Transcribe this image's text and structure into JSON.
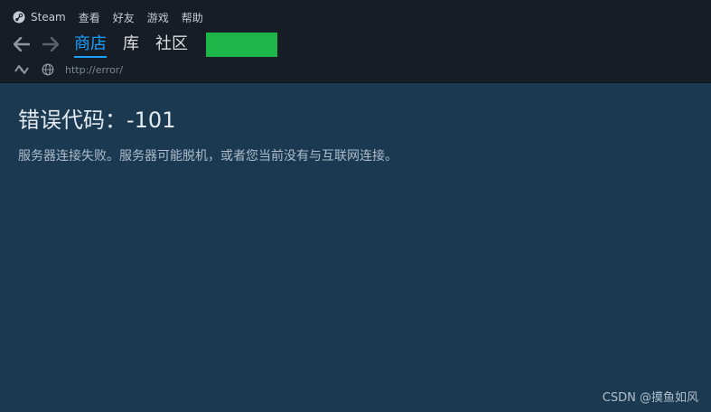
{
  "menubar": {
    "app_name": "Steam",
    "items": [
      "查看",
      "好友",
      "游戏",
      "帮助"
    ]
  },
  "nav": {
    "tabs": [
      {
        "label": "商店",
        "active": true
      },
      {
        "label": "库",
        "active": false
      },
      {
        "label": "社区",
        "active": false
      }
    ],
    "account_button_color": "#1fb649"
  },
  "urlbar": {
    "url": "http://error/"
  },
  "error": {
    "title": "错误代码：-101",
    "message": "服务器连接失败。服务器可能脱机，或者您当前没有与互联网连接。"
  },
  "watermark": "CSDN @摸鱼如风",
  "colors": {
    "accent": "#1a9fff",
    "content_bg": "#1b3a51",
    "chrome_bg": "#171d25"
  }
}
